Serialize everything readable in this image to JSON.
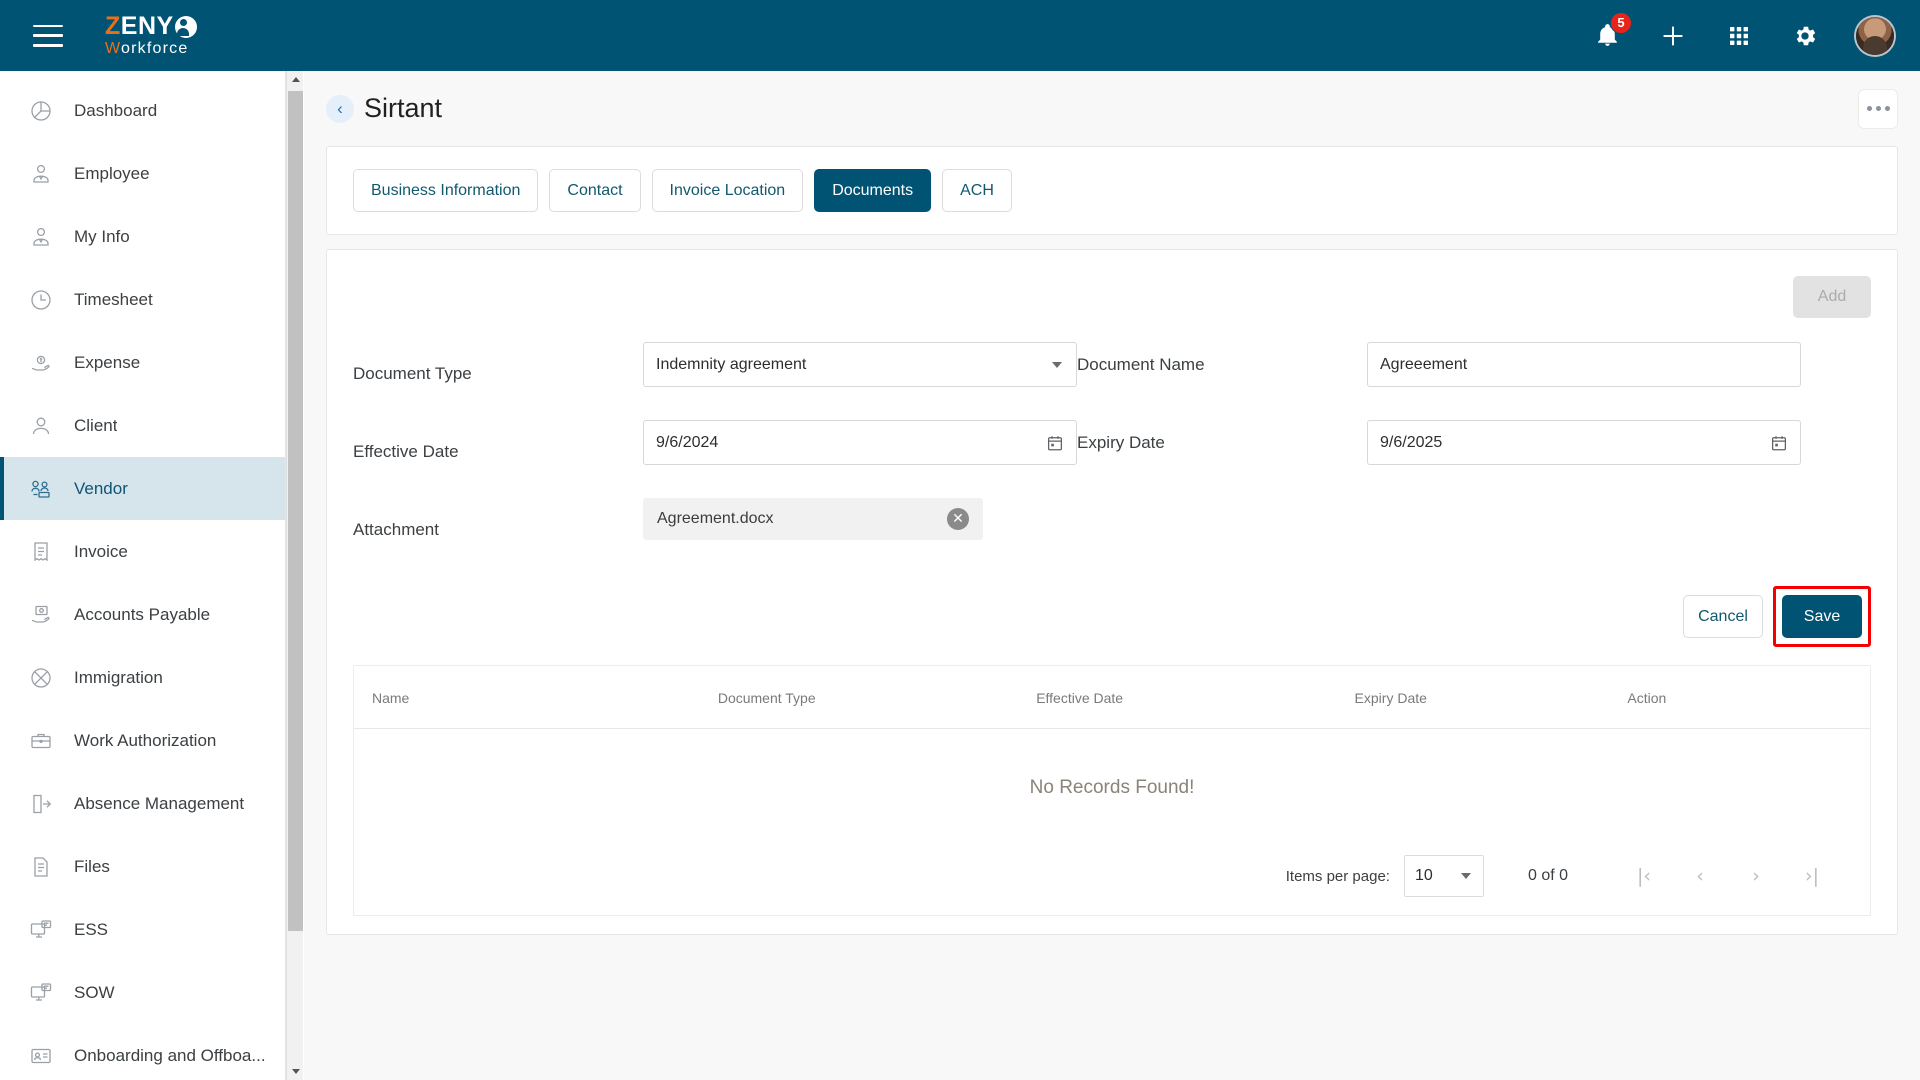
{
  "app": {
    "brand_mark": "Z",
    "brand_name": "ENY",
    "brand_sub_first": "W",
    "brand_sub_rest": "orkforce",
    "accent_color": "#015374",
    "brand_orange": "#e8701a",
    "highlight_color": "#f50000"
  },
  "topbar": {
    "menu_icon": "hamburger-icon",
    "notifications_icon": "bell-icon",
    "notifications_badge": "5",
    "add_icon": "plus-icon",
    "apps_icon": "grid-apps-icon",
    "settings_icon": "gear-icon",
    "avatar_icon": "user-avatar"
  },
  "sidebar": {
    "items": [
      {
        "label": "Dashboard",
        "icon": "pie-chart-icon",
        "active": false
      },
      {
        "label": "Employee",
        "icon": "employee-icon",
        "active": false
      },
      {
        "label": "My Info",
        "icon": "my-info-icon",
        "active": false
      },
      {
        "label": "Timesheet",
        "icon": "clock-icon",
        "active": false
      },
      {
        "label": "Expense",
        "icon": "expense-hand-icon",
        "active": false
      },
      {
        "label": "Client",
        "icon": "person-icon",
        "active": false
      },
      {
        "label": "Vendor",
        "icon": "vendor-icon",
        "active": true
      },
      {
        "label": "Invoice",
        "icon": "invoice-icon",
        "active": false
      },
      {
        "label": "Accounts Payable",
        "icon": "accounts-payable-icon",
        "active": false
      },
      {
        "label": "Immigration",
        "icon": "globe-icon",
        "active": false
      },
      {
        "label": "Work Authorization",
        "icon": "briefcase-icon",
        "active": false
      },
      {
        "label": "Absence Management",
        "icon": "exit-door-icon",
        "active": false
      },
      {
        "label": "Files",
        "icon": "document-icon",
        "active": false
      },
      {
        "label": "ESS",
        "icon": "self-service-icon",
        "active": false
      },
      {
        "label": "SOW",
        "icon": "sow-icon",
        "active": false
      },
      {
        "label": "Onboarding and Offboa...",
        "icon": "id-card-icon",
        "active": false
      }
    ]
  },
  "page": {
    "back_icon": "chevron-left-icon",
    "title": "Sirtant",
    "more_icon": "kebab-menu-icon"
  },
  "tabs": [
    {
      "label": "Business Information",
      "active": false
    },
    {
      "label": "Contact",
      "active": false
    },
    {
      "label": "Invoice Location",
      "active": false
    },
    {
      "label": "Documents",
      "active": true
    },
    {
      "label": "ACH",
      "active": false
    }
  ],
  "form": {
    "add_label": "Add",
    "document_type": {
      "label": "Document Type",
      "value": "Indemnity agreement",
      "icon": "chevron-down-icon"
    },
    "document_name": {
      "label": "Document Name",
      "value": "Agreeement"
    },
    "effective_date": {
      "label": "Effective Date",
      "value": "9/6/2024",
      "icon": "calendar-icon"
    },
    "expiry_date": {
      "label": "Expiry Date",
      "value": "9/6/2025",
      "icon": "calendar-icon"
    },
    "attachment": {
      "label": "Attachment",
      "value": "Agreement.docx",
      "remove_icon": "close-circle-icon"
    },
    "cancel_label": "Cancel",
    "save_label": "Save"
  },
  "table": {
    "columns": [
      "Name",
      "Document Type",
      "Effective Date",
      "Expiry Date",
      "Action"
    ],
    "rows": [],
    "empty_message": "No Records Found!"
  },
  "paginator": {
    "items_per_page_label": "Items per page:",
    "items_per_page_value": "10",
    "range_label": "0 of 0",
    "first_icon": "first-page-icon",
    "prev_icon": "prev-page-icon",
    "next_icon": "next-page-icon",
    "last_icon": "last-page-icon",
    "first_glyph": "|‹",
    "prev_glyph": "‹",
    "next_glyph": "›",
    "last_glyph": "›|"
  }
}
